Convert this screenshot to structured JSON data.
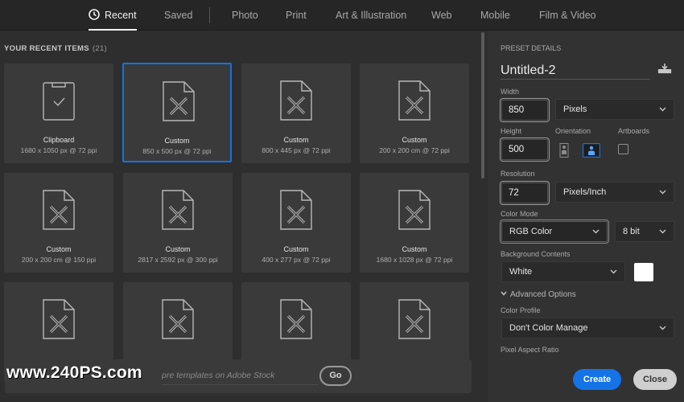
{
  "tabs": [
    {
      "label": "Recent",
      "active": true
    },
    {
      "label": "Saved"
    },
    {
      "label": "Photo"
    },
    {
      "label": "Print"
    },
    {
      "label": "Art & Illustration"
    },
    {
      "label": "Web"
    },
    {
      "label": "Mobile"
    },
    {
      "label": "Film & Video"
    }
  ],
  "recent": {
    "title": "YOUR RECENT ITEMS",
    "count": "(21)",
    "items": [
      {
        "name": "Clipboard",
        "size": "1680 x 1050 px @ 72 ppi",
        "icon": "clipboard-icon"
      },
      {
        "name": "Custom",
        "size": "850 x 500 px @ 72 ppi",
        "icon": "document-icon",
        "selected": true
      },
      {
        "name": "Custom",
        "size": "800 x 445 px @ 72 ppi",
        "icon": "document-icon"
      },
      {
        "name": "Custom",
        "size": "200 x 200 cm @ 72 ppi",
        "icon": "document-icon"
      },
      {
        "name": "Custom",
        "size": "200 x 200 cm @ 150 ppi",
        "icon": "document-icon"
      },
      {
        "name": "Custom",
        "size": "2817 x 2592 px @ 300 ppi",
        "icon": "document-icon"
      },
      {
        "name": "Custom",
        "size": "400 x 277 px @ 72 ppi",
        "icon": "document-icon"
      },
      {
        "name": "Custom",
        "size": "1680 x 1028 px @ 72 ppi",
        "icon": "document-icon"
      },
      {
        "name": "",
        "size": "",
        "icon": "document-icon"
      },
      {
        "name": "",
        "size": "",
        "icon": "document-icon"
      },
      {
        "name": "",
        "size": "",
        "icon": "document-icon"
      },
      {
        "name": "",
        "size": "",
        "icon": "document-icon"
      }
    ]
  },
  "stock": {
    "placeholder": "pre templates on Adobe Stock",
    "go_label": "Go"
  },
  "watermark": "www.240PS.com",
  "preset": {
    "header": "PRESET DETAILS",
    "name": "Untitled-2",
    "width_label": "Width",
    "width_value": "850",
    "width_unit": "Pixels",
    "height_label": "Height",
    "height_value": "500",
    "orientation_label": "Orientation",
    "artboards_label": "Artboards",
    "artboards_checked": false,
    "resolution_label": "Resolution",
    "resolution_value": "72",
    "resolution_unit": "Pixels/Inch",
    "color_mode_label": "Color Mode",
    "color_mode": "RGB Color",
    "bit_depth": "8 bit",
    "background_label": "Background Contents",
    "background": "White",
    "background_color": "#ffffff",
    "advanced_label": "Advanced Options",
    "profile_label": "Color Profile",
    "profile": "Don't Color Manage",
    "pixel_aspect_label": "Pixel Aspect Ratio",
    "create_label": "Create",
    "close_label": "Close"
  },
  "colors": {
    "accent": "#1473e6",
    "panel": "#323232",
    "background": "#2e2e2e",
    "card": "#3a3a3a"
  }
}
